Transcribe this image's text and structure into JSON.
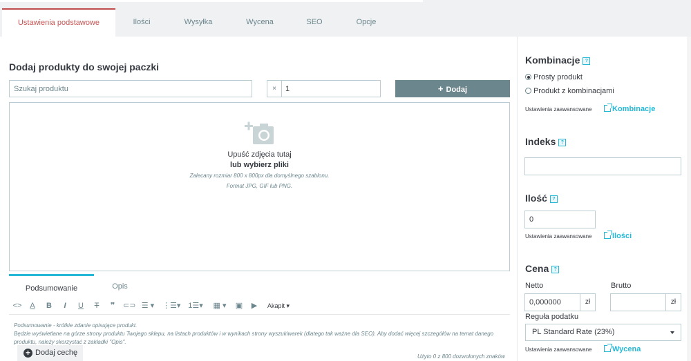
{
  "tabs": [
    {
      "label": "Ustawienia podstawowe",
      "active": true
    },
    {
      "label": "Ilości",
      "active": false
    },
    {
      "label": "Wysyłka",
      "active": false
    },
    {
      "label": "Wycena",
      "active": false
    },
    {
      "label": "SEO",
      "active": false
    },
    {
      "label": "Opcje",
      "active": false
    }
  ],
  "pack": {
    "title": "Dodaj produkty do swojej paczki",
    "search_placeholder": "Szukaj produktu",
    "qty_prefix": "×",
    "qty_value": "1",
    "add_label": "Dodaj"
  },
  "dropzone": {
    "line1": "Upuść zdjęcia tutaj",
    "line2": "lub wybierz pliki",
    "line3": "Zalecany rozmiar 800 x 800px dla domyślnego szablonu.",
    "line4": "Format JPG, GIF lub PNG."
  },
  "description": {
    "tabs": [
      "Podsumowanie",
      "Opis"
    ],
    "toolbar_paragraph": "Akapit",
    "text": "Podsumowanie - krótkie zdanie opisujące produkt.\nBędzie wyświetlane na górze strony produktu Twojego sklepu, na listach produktów i w wynikach strony wyszukiwarek (dlatego tak ważne dla SEO). Aby dodać więcej szczegółów na temat danego produktu, należy skorzystać z zakładki \"Opis\".",
    "counter": "Użyto 0 z 800 dozwolonych znaków",
    "add_feature": "Dodaj cechę"
  },
  "combinations": {
    "title": "Kombinacje",
    "options": [
      {
        "label": "Prosty produkt",
        "checked": true
      },
      {
        "label": "Produkt z kombinacjami",
        "checked": false
      }
    ],
    "advanced_label": "Ustawienia zaawansowane",
    "advanced_link": "Kombinacje"
  },
  "reference": {
    "title": "Indeks",
    "value": ""
  },
  "quantity": {
    "title": "Ilość",
    "value": "0",
    "advanced_label": "Ustawienia zaawansowane",
    "advanced_link": "Ilości"
  },
  "price": {
    "title": "Cena",
    "net_label": "Netto",
    "gross_label": "Brutto",
    "net_value": "0,000000",
    "gross_value": "",
    "currency": "zł",
    "tax_label": "Reguła podatku",
    "tax_value": "PL Standard Rate (23%)",
    "advanced_label": "Ustawienia zaawansowane",
    "advanced_link": "Wycena"
  },
  "colors": {
    "accent": "#25b9d7",
    "active_tab": "#c04b4b",
    "button": "#6c868e"
  }
}
